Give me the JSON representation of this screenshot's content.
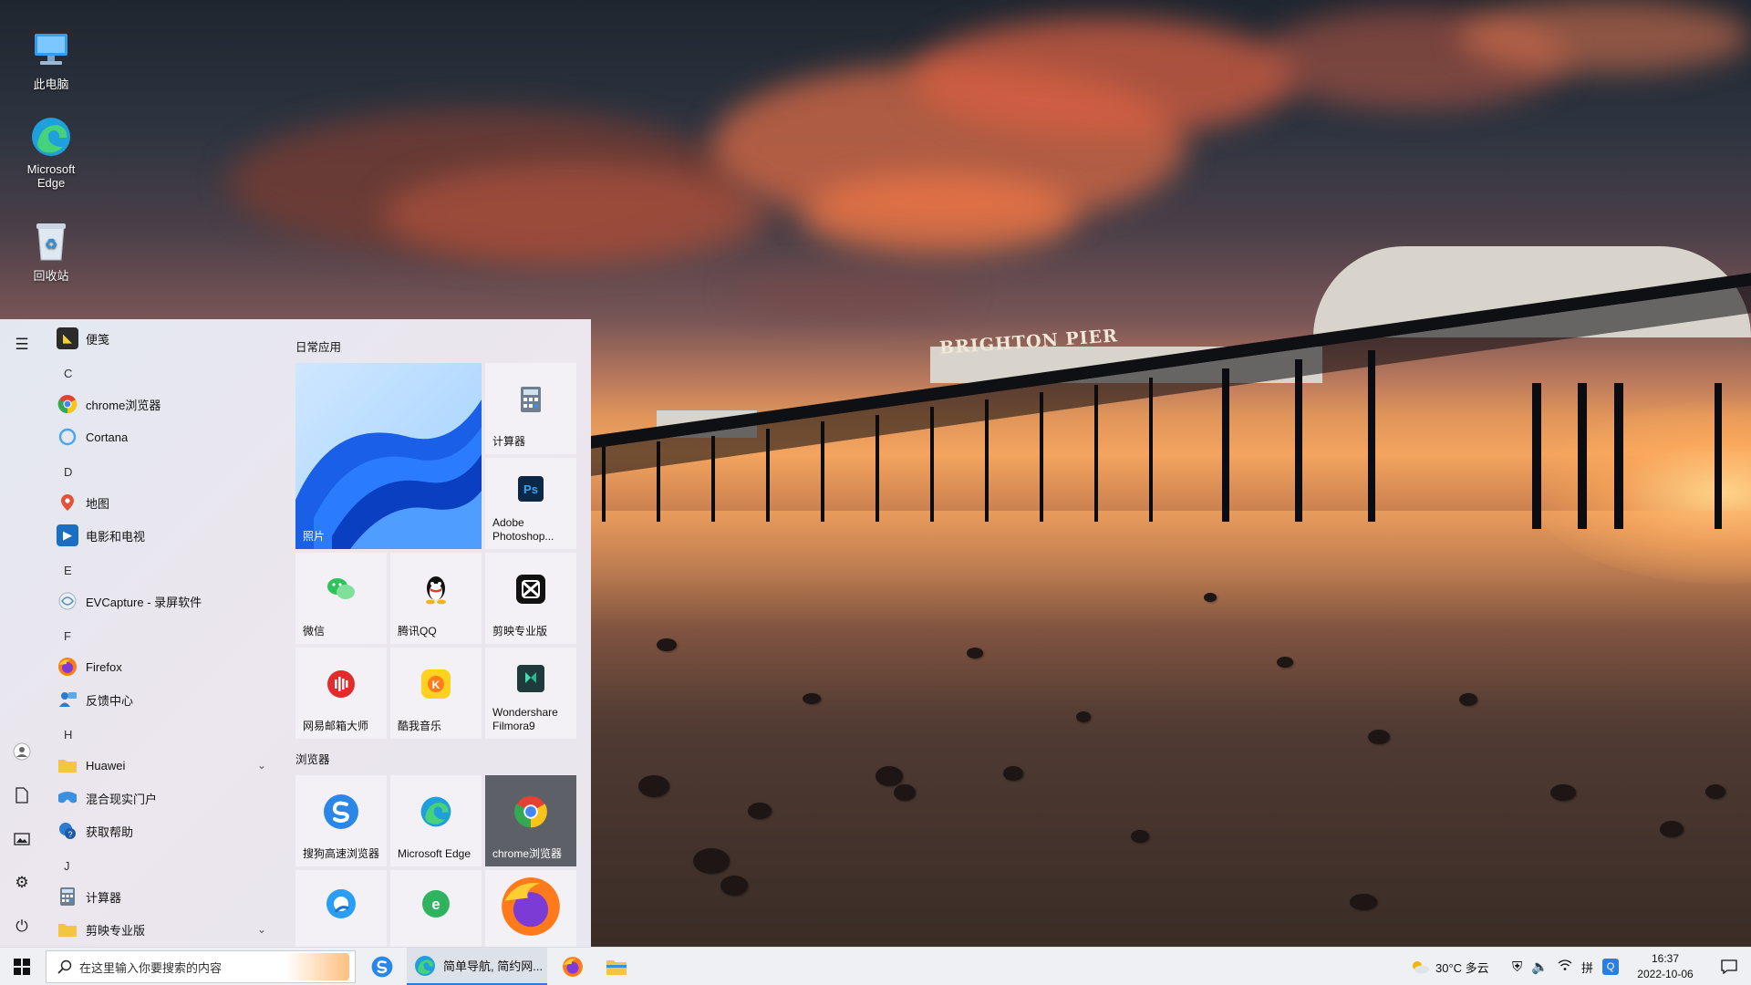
{
  "desktop": {
    "icons": [
      {
        "label": "此电脑",
        "icon": "computer-icon"
      },
      {
        "label": "Microsoft Edge",
        "icon": "edge-icon"
      },
      {
        "label": "回收站",
        "icon": "recycle-bin-icon"
      }
    ],
    "pier_sign": "BRIGHTON PIER"
  },
  "start_menu": {
    "rail": [
      "menu-icon",
      "user-icon",
      "documents-icon",
      "pictures-icon",
      "settings-icon",
      "power-icon"
    ],
    "app_list": {
      "top_item": "便笺",
      "letter_c": "C",
      "chrome": "chrome浏览器",
      "cortana": "Cortana",
      "letter_d": "D",
      "maps": "地图",
      "movies": "电影和电视",
      "letter_e": "E",
      "evcapture": "EVCapture - 录屏软件",
      "letter_f": "F",
      "firefox": "Firefox",
      "feedback": "反馈中心",
      "letter_h": "H",
      "huawei": "Huawei",
      "mixed_reality": "混合现实门户",
      "get_help": "获取帮助",
      "letter_j": "J",
      "calculator": "计算器",
      "jianying": "剪映专业版"
    },
    "groups": {
      "daily": "日常应用",
      "browsers": "浏览器"
    },
    "tiles": {
      "photos": "照片",
      "calculator": "计算器",
      "photoshop": "Adobe Photoshop...",
      "wechat": "微信",
      "qq": "腾讯QQ",
      "jianying": "剪映专业版",
      "netease_mail": "网易邮箱大师",
      "kuwo": "酷我音乐",
      "filmora": "Wondershare Filmora9",
      "sogou": "搜狗高速浏览器",
      "edge": "Microsoft Edge",
      "chrome": "chrome浏览器"
    }
  },
  "taskbar": {
    "search_placeholder": "在这里输入你要搜索的内容",
    "edge_task": "简单导航, 简约网...",
    "weather": "30°C 多云",
    "time": "16:37",
    "date": "2022-10-06"
  }
}
